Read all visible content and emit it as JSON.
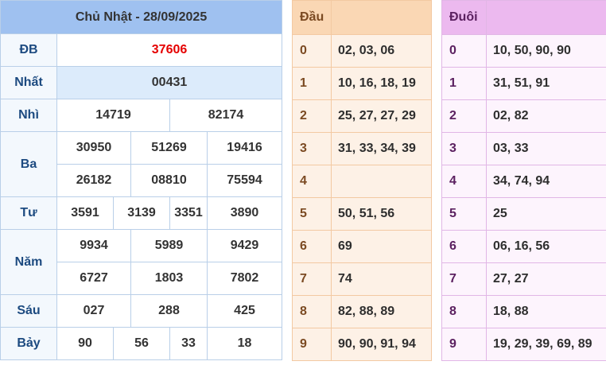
{
  "results": {
    "title": "Chủ Nhật - 28/09/2025",
    "rows": {
      "db": {
        "label": "ĐB",
        "values": [
          "37606"
        ]
      },
      "nhat": {
        "label": "Nhất",
        "values": [
          "00431"
        ]
      },
      "nhi": {
        "label": "Nhì",
        "values": [
          "14719",
          "82174"
        ]
      },
      "ba": {
        "label": "Ba",
        "values": [
          "30950",
          "51269",
          "19416",
          "26182",
          "08810",
          "75594"
        ]
      },
      "tu": {
        "label": "Tư",
        "values": [
          "3591",
          "3139",
          "3351",
          "3890"
        ]
      },
      "nam": {
        "label": "Năm",
        "values": [
          "9934",
          "5989",
          "9429",
          "6727",
          "1803",
          "7802"
        ]
      },
      "sau": {
        "label": "Sáu",
        "values": [
          "027",
          "288",
          "425"
        ]
      },
      "bay": {
        "label": "Bảy",
        "values": [
          "90",
          "56",
          "33",
          "18"
        ]
      }
    }
  },
  "dau": {
    "title": "Đầu",
    "rows": [
      {
        "key": "0",
        "value": "02, 03, 06"
      },
      {
        "key": "1",
        "value": "10, 16, 18, 19"
      },
      {
        "key": "2",
        "value": "25, 27, 27, 29"
      },
      {
        "key": "3",
        "value": "31, 33, 34, 39"
      },
      {
        "key": "4",
        "value": ""
      },
      {
        "key": "5",
        "value": "50, 51, 56"
      },
      {
        "key": "6",
        "value": "69"
      },
      {
        "key": "7",
        "value": "74"
      },
      {
        "key": "8",
        "value": "82, 88, 89"
      },
      {
        "key": "9",
        "value": "90, 90, 91, 94"
      }
    ]
  },
  "duoi": {
    "title": "Đuôi",
    "rows": [
      {
        "key": "0",
        "value": "10, 50, 90, 90"
      },
      {
        "key": "1",
        "value": "31, 51, 91"
      },
      {
        "key": "2",
        "value": "02, 82"
      },
      {
        "key": "3",
        "value": "03, 33"
      },
      {
        "key": "4",
        "value": "34, 74, 94"
      },
      {
        "key": "5",
        "value": "25"
      },
      {
        "key": "6",
        "value": "06, 16, 56"
      },
      {
        "key": "7",
        "value": "27, 27"
      },
      {
        "key": "8",
        "value": "18, 88"
      },
      {
        "key": "9",
        "value": "19, 29, 39, 69, 89"
      }
    ]
  },
  "colors": {
    "results_header": "#9fc1f0",
    "special_prize": "#e50000",
    "dau_header": "#fad7b4",
    "duoi_header": "#ecb9ef"
  }
}
